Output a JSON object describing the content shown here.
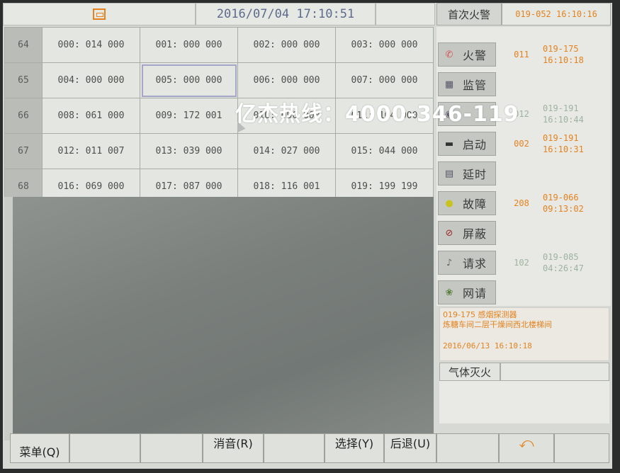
{
  "header": {
    "home_icon": "home-icon",
    "datetime": "2016/07/04 17:10:51"
  },
  "grid": {
    "rows": [
      {
        "no": "64",
        "cells": [
          "000: 014 000",
          "001: 000 000",
          "002: 000 000",
          "003: 000 000"
        ]
      },
      {
        "no": "65",
        "cells": [
          "004: 000 000",
          "005: 000 000",
          "006: 000 000",
          "007: 000 000"
        ]
      },
      {
        "no": "66",
        "cells": [
          "008: 061 000",
          "009: 172 001",
          "010: 090 000",
          "011: 104 000"
        ]
      },
      {
        "no": "67",
        "cells": [
          "012: 011 007",
          "013: 039 000",
          "014: 027 000",
          "015: 044 000"
        ]
      },
      {
        "no": "68",
        "cells": [
          "016: 069 000",
          "017: 087 000",
          "018: 116 001",
          "019: 199 199"
        ]
      }
    ],
    "selected_cell": "005: 000 000"
  },
  "right_panel": {
    "first_alarm_label": "首次火警",
    "first_alarm_value": "019-052 16:10:16",
    "categories": [
      {
        "label": "火警",
        "icon": "phone-icon",
        "count": "011",
        "event": [
          "019-175",
          "16:10:18"
        ]
      },
      {
        "label": "监管",
        "icon": "chart-icon",
        "count": "",
        "event": []
      },
      {
        "label": "",
        "icon": "feedback-icon",
        "count": "012",
        "event": [
          "019-191",
          "16:10:44"
        ]
      },
      {
        "label": "启动",
        "icon": "gun-icon",
        "count": "002",
        "event": [
          "019-191",
          "16:10:31"
        ]
      },
      {
        "label": "延时",
        "icon": "timer-icon",
        "count": "",
        "event": []
      },
      {
        "label": "故障",
        "icon": "bulb-icon",
        "count": "208",
        "event": [
          "019-066",
          "09:13:02"
        ]
      },
      {
        "label": "屏蔽",
        "icon": "block-icon",
        "count": "",
        "event": []
      },
      {
        "label": "请求",
        "icon": "request-icon",
        "count": "102",
        "event": [
          "019-085",
          "04:26:47"
        ]
      },
      {
        "label": "网请",
        "icon": "network-icon",
        "count": "",
        "event": []
      }
    ],
    "detail": {
      "line1": "019-175 感烟探测器",
      "line2": "炼糖车间二层干燥间西北楼梯间",
      "time": "2016/06/13 16:10:18"
    },
    "gas_label": "气体灭火"
  },
  "bottom_bar": {
    "menu": "菜单(Q)",
    "mute": "消音(R)",
    "select": "选择(Y)",
    "back": "后退(U)",
    "return_icon": "return-arrow-icon"
  },
  "watermark": "亿杰热线：4000-346-119",
  "colors": {
    "accent": "#e5821f",
    "date_blue": "#5d6b8c"
  }
}
